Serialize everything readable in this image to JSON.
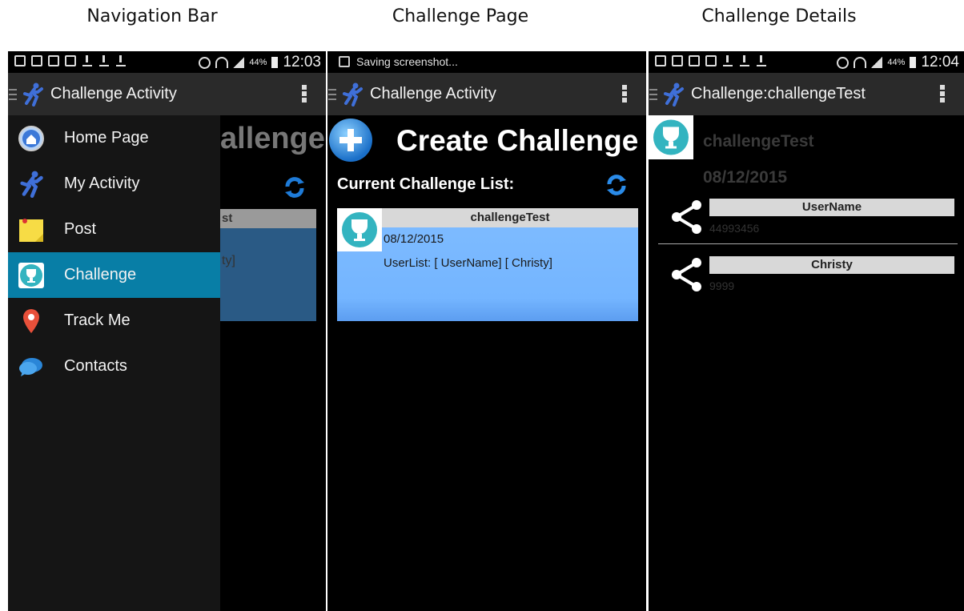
{
  "captions": [
    "Navigation Bar",
    "Challenge Page",
    "Challenge Details"
  ],
  "status": {
    "time_1": "12:03",
    "time_3": "12:04",
    "battery": "44%",
    "saving": "Saving screenshot..."
  },
  "screen1": {
    "title": "Challenge Activity",
    "bg_heading": "allenge",
    "bg_card_head": "st",
    "bg_card_text": "ty]",
    "nav": [
      {
        "label": "Home Page",
        "icon": "home-icon"
      },
      {
        "label": "My Activity",
        "icon": "runner-icon"
      },
      {
        "label": "Post",
        "icon": "sticky-note-icon"
      },
      {
        "label": "Challenge",
        "icon": "trophy-icon"
      },
      {
        "label": "Track Me",
        "icon": "map-pin-icon"
      },
      {
        "label": "Contacts",
        "icon": "chat-bubble-icon"
      }
    ]
  },
  "screen2": {
    "title": "Challenge Activity",
    "create_label": "Create Challenge",
    "list_label": "Current Challenge List:",
    "challenge": {
      "name": "challengeTest",
      "date": "08/12/2015",
      "users": "UserList: [ UserName] [ Christy]"
    }
  },
  "screen3": {
    "title": "Challenge:challengeTest",
    "name": "challengeTest",
    "date": "08/12/2015",
    "participants": [
      {
        "name": "UserName",
        "value": "44993456"
      },
      {
        "name": "Christy",
        "value": "9999"
      }
    ]
  },
  "colors": {
    "active_nav": "#087ea6",
    "card_blue": "#7fbcff",
    "action_bar": "#2a2a2a"
  }
}
